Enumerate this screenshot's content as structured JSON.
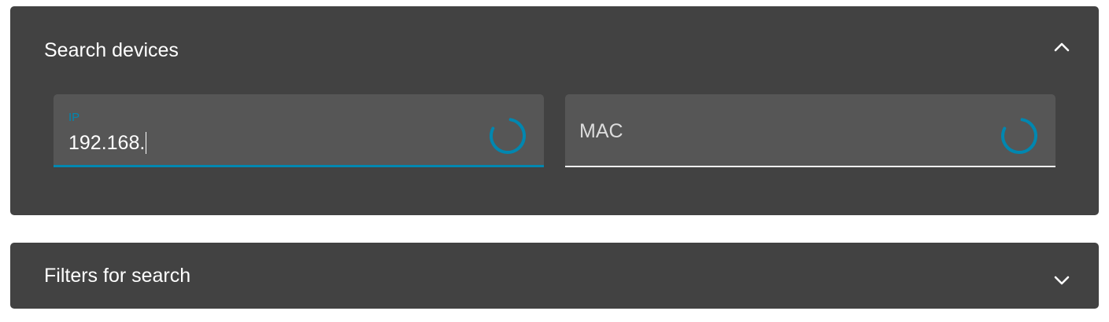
{
  "search_panel": {
    "title": "Search devices",
    "toggle_icon": "chevron-up-icon",
    "ip_field": {
      "label": "IP",
      "value": "192.168.",
      "status_icon": "loading-spinner-icon"
    },
    "mac_field": {
      "label": "MAC",
      "value": "",
      "status_icon": "loading-spinner-icon"
    }
  },
  "filters_panel": {
    "title": "Filters for search",
    "toggle_icon": "chevron-down-icon"
  },
  "colors": {
    "panel_background": "#424242",
    "field_background": "#565656",
    "accent": "#0087b0",
    "text": "#ffffff"
  }
}
